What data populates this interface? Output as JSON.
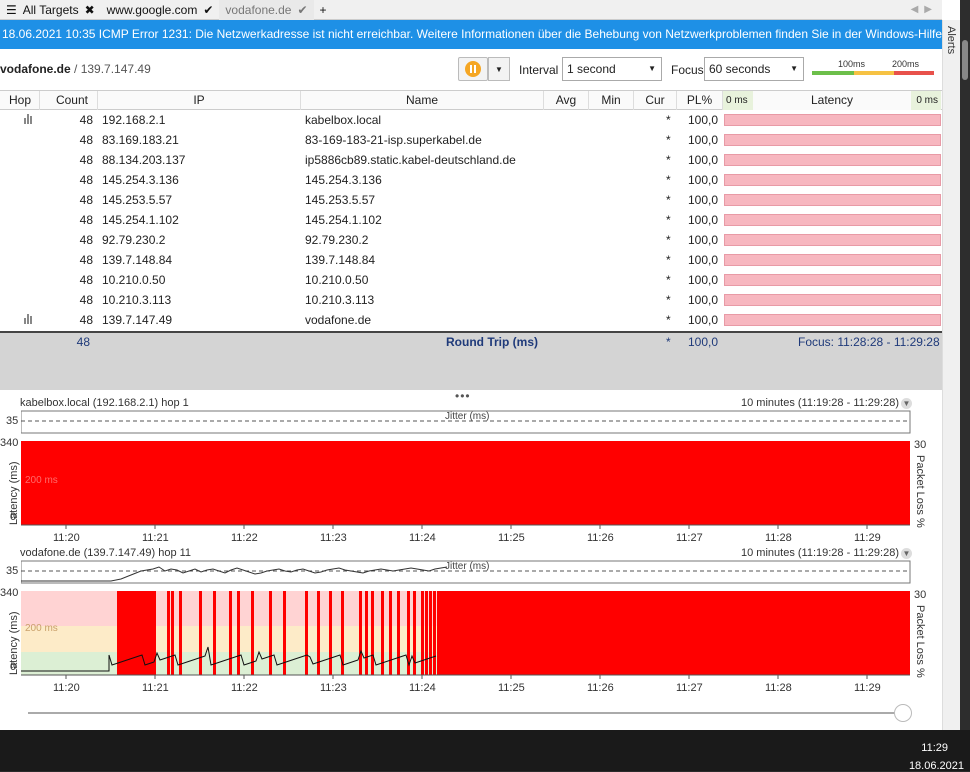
{
  "tabs": [
    {
      "label": "All Targets",
      "mark": "✖"
    },
    {
      "label": "www.google.com",
      "mark": "✔"
    },
    {
      "label": "vodafone.de",
      "mark": "✔"
    }
  ],
  "tab_add": "+",
  "banner": "18.06.2021 10:35 ICMP Error 1231: Die Netzwerkadresse ist nicht erreichbar. Weitere Informationen über die Behebung von Netzwerkproblemen finden Sie in der Windows-Hilfe",
  "alerts_label": "Alerts",
  "target": {
    "host": "vodafone.de",
    "ip": " / 139.7.147.49"
  },
  "toolbar": {
    "interval_label": "Interval",
    "interval_value": "1 second",
    "focus_label": "Focus",
    "focus_value": "60 seconds",
    "scale_100": "100ms",
    "scale_200": "200ms"
  },
  "columns": {
    "hop": "Hop",
    "count": "Count",
    "ip": "IP",
    "name": "Name",
    "avg": "Avg",
    "min": "Min",
    "cur": "Cur",
    "pl": "PL%",
    "lat_left": "0 ms",
    "latency": "Latency",
    "lat_right": "0 ms"
  },
  "hops": [
    {
      "count": "48",
      "ip": "192.168.2.1",
      "name": "kabelbox.local",
      "cur": "*",
      "pl": "100,0",
      "icon": true
    },
    {
      "count": "48",
      "ip": "83.169.183.21",
      "name": "83-169-183-21-isp.superkabel.de",
      "cur": "*",
      "pl": "100,0",
      "icon": false
    },
    {
      "count": "48",
      "ip": "88.134.203.137",
      "name": "ip5886cb89.static.kabel-deutschland.de",
      "cur": "*",
      "pl": "100,0",
      "icon": false
    },
    {
      "count": "48",
      "ip": "145.254.3.136",
      "name": "145.254.3.136",
      "cur": "*",
      "pl": "100,0",
      "icon": false
    },
    {
      "count": "48",
      "ip": "145.253.5.57",
      "name": "145.253.5.57",
      "cur": "*",
      "pl": "100,0",
      "icon": false
    },
    {
      "count": "48",
      "ip": "145.254.1.102",
      "name": "145.254.1.102",
      "cur": "*",
      "pl": "100,0",
      "icon": false
    },
    {
      "count": "48",
      "ip": "92.79.230.2",
      "name": "92.79.230.2",
      "cur": "*",
      "pl": "100,0",
      "icon": false
    },
    {
      "count": "48",
      "ip": "139.7.148.84",
      "name": "139.7.148.84",
      "cur": "*",
      "pl": "100,0",
      "icon": false
    },
    {
      "count": "48",
      "ip": "10.210.0.50",
      "name": "10.210.0.50",
      "cur": "*",
      "pl": "100,0",
      "icon": false
    },
    {
      "count": "48",
      "ip": "10.210.3.113",
      "name": "10.210.3.113",
      "cur": "*",
      "pl": "100,0",
      "icon": false
    },
    {
      "count": "48",
      "ip": "139.7.147.49",
      "name": "vodafone.de",
      "cur": "*",
      "pl": "100,0",
      "icon": true
    }
  ],
  "summary": {
    "count": "48",
    "label": "Round Trip (ms)",
    "cur": "*",
    "pl": "100,0",
    "focus": "Focus: 11:28:28 - 11:29:28"
  },
  "splitter": "•••",
  "graphs": [
    {
      "title": "kabelbox.local (192.168.2.1) hop 1",
      "range": "10 minutes (11:19:28 - 11:29:28)",
      "jitter_label": "Jitter (ms)",
      "jitter_max": "35",
      "lat_max": "340",
      "lat_zero": "0",
      "pl_max": "30",
      "mid_label": "200 ms",
      "ylabel": "Latency (ms)",
      "y2label": "Packet Loss %"
    },
    {
      "title": "vodafone.de (139.7.147.49) hop 11",
      "range": "10 minutes (11:19:28 - 11:29:28)",
      "jitter_label": "Jitter (ms)",
      "jitter_max": "35",
      "lat_max": "340",
      "lat_zero": "0",
      "pl_max": "30",
      "mid_label": "200 ms",
      "ylabel": "Latency (ms)",
      "y2label": "Packet Loss %"
    }
  ],
  "xticks": [
    "11:20",
    "11:21",
    "11:22",
    "11:23",
    "11:24",
    "11:25",
    "11:26",
    "11:27",
    "11:28",
    "11:29"
  ],
  "taskbar": {
    "time": "11:29",
    "date": "18.06.2021"
  },
  "colors": {
    "banner": "#1e90e6",
    "loss": "#ff0000",
    "bar_ok": "#f7b7c0",
    "pause": "#f5a623"
  }
}
